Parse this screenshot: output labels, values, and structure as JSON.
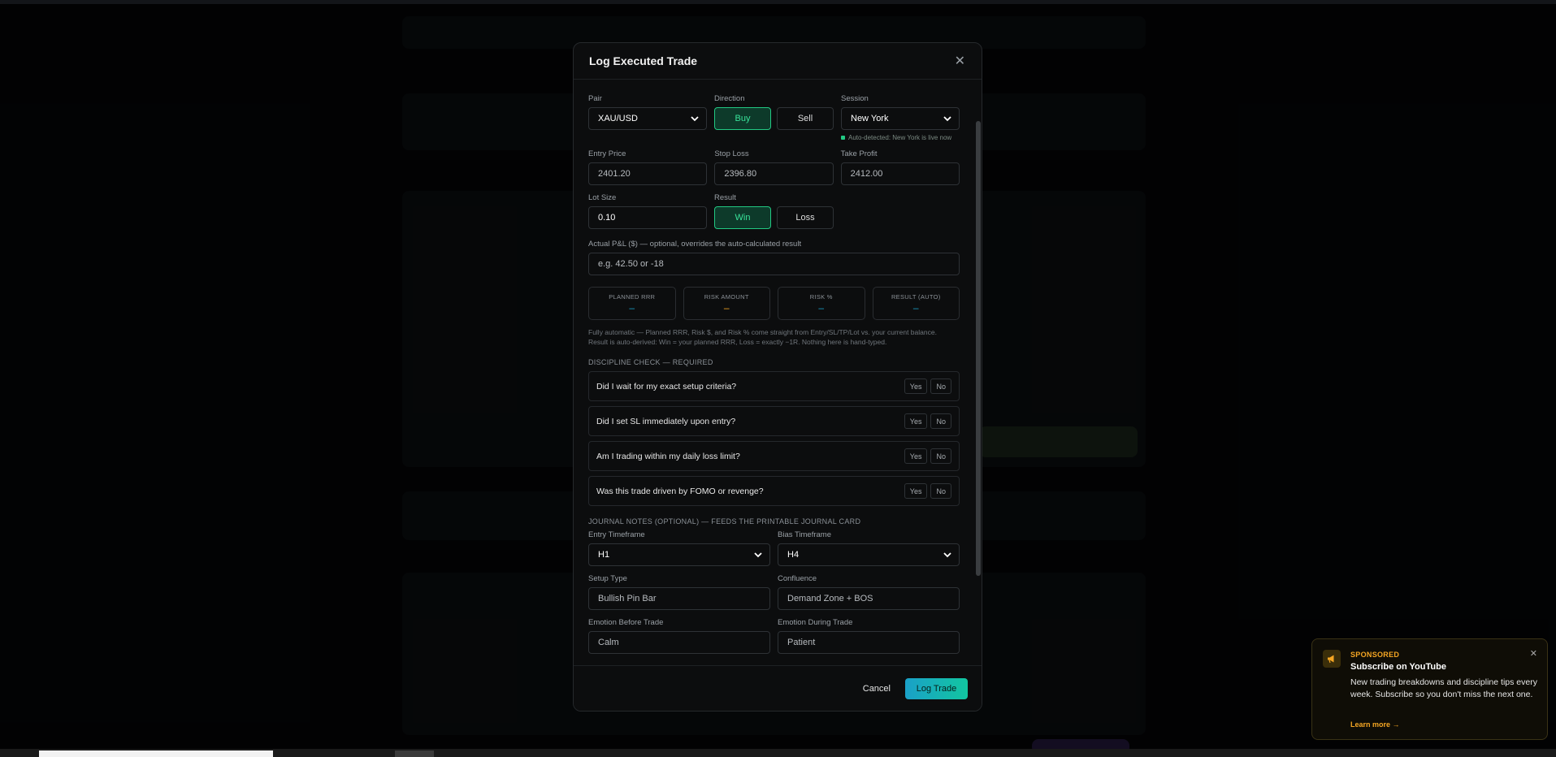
{
  "modal": {
    "title": "Log Executed Trade",
    "pair": {
      "label": "Pair",
      "value": "XAU/USD"
    },
    "direction": {
      "label": "Direction",
      "buy": "Buy",
      "sell": "Sell",
      "selected": "Buy"
    },
    "session": {
      "label": "Session",
      "value": "New York",
      "hint": "Auto-detected: New York is live now"
    },
    "entry": {
      "label": "Entry Price",
      "placeholder": "2401.20"
    },
    "stop": {
      "label": "Stop Loss",
      "placeholder": "2396.80"
    },
    "take": {
      "label": "Take Profit",
      "placeholder": "2412.00"
    },
    "lot": {
      "label": "Lot Size",
      "value": "0.10"
    },
    "result": {
      "label": "Result",
      "win": "Win",
      "loss": "Loss",
      "selected": "Win"
    },
    "pnl": {
      "label": "Actual P&L ($) — optional, overrides the auto-calculated result",
      "placeholder": "e.g. 42.50 or -18"
    },
    "stats": [
      {
        "key": "PLANNED RRR",
        "value": "–",
        "color": "#1aa0c8"
      },
      {
        "key": "RISK AMOUNT",
        "value": "–",
        "color": "#f5a623"
      },
      {
        "key": "RISK %",
        "value": "–",
        "color": "#1aa0c8"
      },
      {
        "key": "RESULT (AUTO)",
        "value": "–",
        "color": "#1aa0c8"
      }
    ],
    "note_line1": "Fully automatic — Planned RRR, Risk $, and Risk % come straight from Entry/SL/TP/Lot vs. your current balance.",
    "note_line2": "Result is auto-derived: Win = your planned RRR, Loss = exactly −1R. Nothing here is hand-typed.",
    "discipline_title": "DISCIPLINE CHECK — REQUIRED",
    "questions": [
      "Did I wait for my exact setup criteria?",
      "Did I set SL immediately upon entry?",
      "Am I trading within my daily loss limit?",
      "Was this trade driven by FOMO or revenge?"
    ],
    "yes": "Yes",
    "no": "No",
    "journal_title": "JOURNAL NOTES (OPTIONAL) — FEEDS THE PRINTABLE JOURNAL CARD",
    "entry_tf": {
      "label": "Entry Timeframe",
      "value": "H1"
    },
    "bias_tf": {
      "label": "Bias Timeframe",
      "value": "H4"
    },
    "setup": {
      "label": "Setup Type",
      "placeholder": "Bullish Pin Bar"
    },
    "confluence": {
      "label": "Confluence",
      "placeholder": "Demand Zone + BOS"
    },
    "emo_before": {
      "label": "Emotion Before Trade",
      "placeholder": "Calm"
    },
    "emo_during": {
      "label": "Emotion During Trade",
      "placeholder": "Patient"
    },
    "cancel": "Cancel",
    "submit": "Log Trade"
  },
  "toast": {
    "tag": "SPONSORED",
    "title": "Subscribe on YouTube",
    "body": "New trading breakdowns and discipline tips every week. Subscribe so you don't miss the next one.",
    "link": "Learn more →"
  },
  "colors": {
    "accent_green": "#22c983",
    "accent_orange": "#f5a623",
    "accent_blue": "#1aa0c8"
  }
}
